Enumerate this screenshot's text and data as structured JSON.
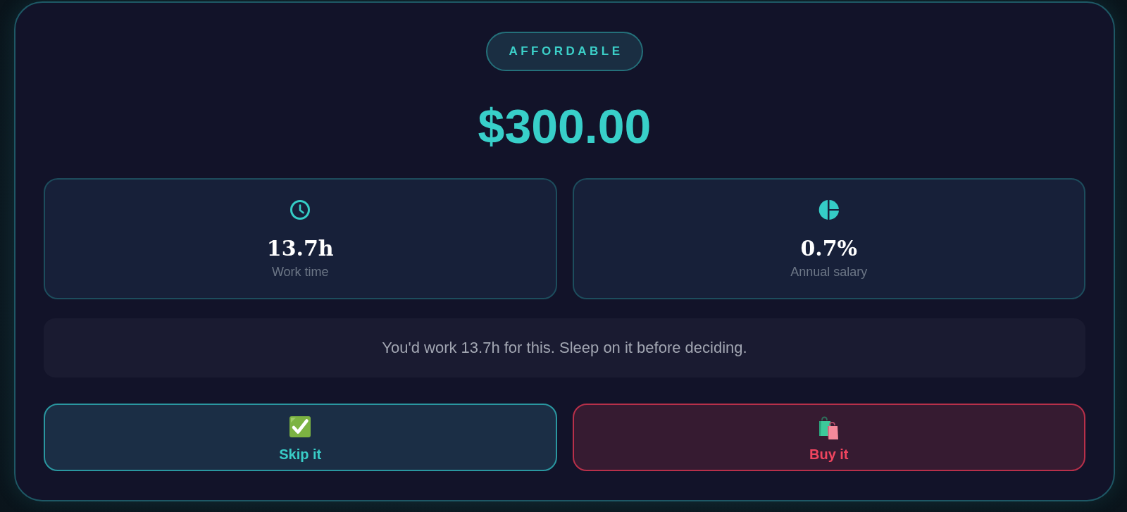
{
  "verdict_badge": {
    "label": "AFFORDABLE"
  },
  "price": "$300.00",
  "stats": [
    {
      "kind": "clock",
      "value": "13.7h",
      "label": "Work time"
    },
    {
      "kind": "pie",
      "value": "0.7%",
      "label": "Annual salary"
    }
  ],
  "message": "You'd work 13.7h for this. Sleep on it before deciding.",
  "actions": [
    {
      "kind": "skip",
      "label": "Skip it"
    },
    {
      "kind": "buy",
      "label": "Buy it"
    }
  ]
}
